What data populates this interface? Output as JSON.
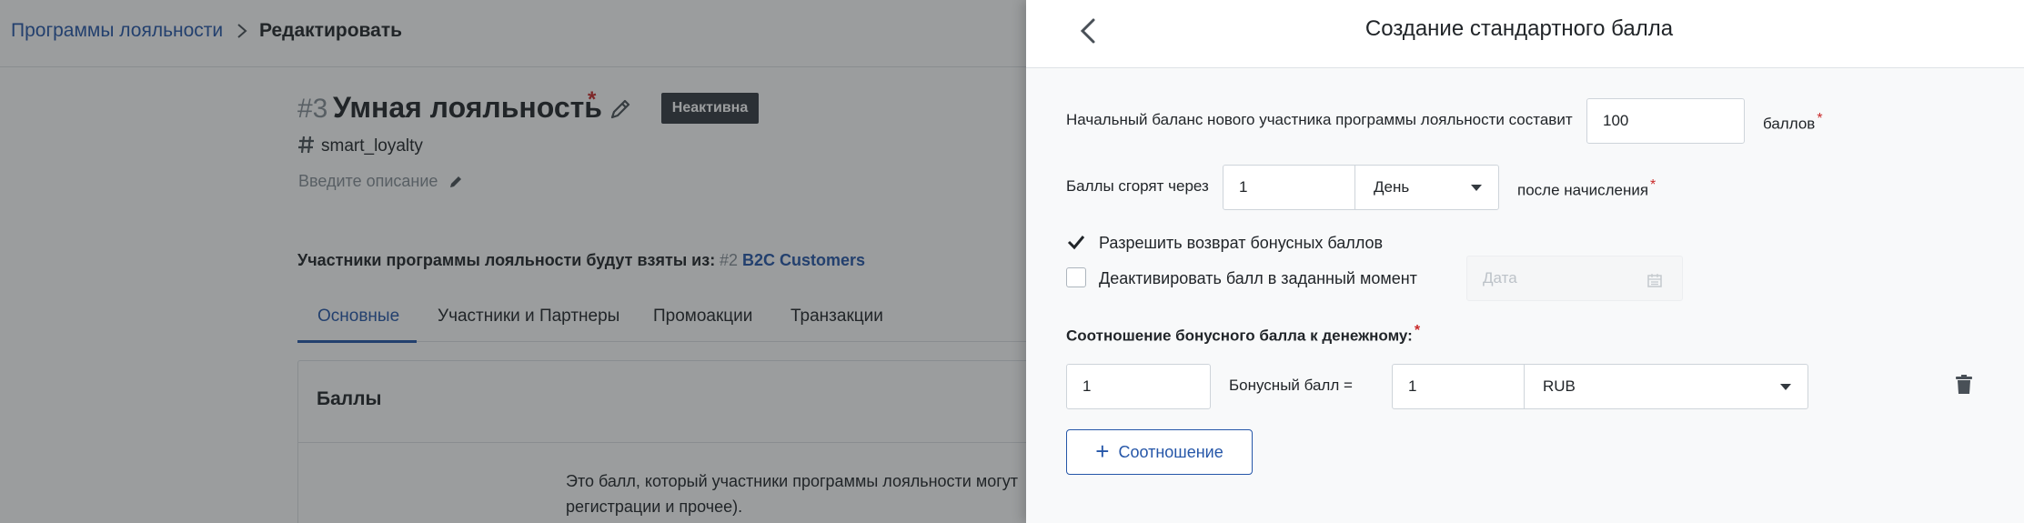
{
  "breadcrumb": {
    "parent": "Программы лояльности",
    "current": "Редактировать"
  },
  "program": {
    "number": "#3",
    "title": "Умная лояльность",
    "required_star": "*",
    "status": "Неактивна",
    "slug": "smart_loyalty",
    "description_placeholder": "Введите описание"
  },
  "source": {
    "label": "Участники программы лояльности будут взяты из:",
    "segment_number": "#2",
    "segment_name": "B2C Customers"
  },
  "tabs": [
    {
      "label": "Основные",
      "active": true
    },
    {
      "label": "Участники и Партнеры",
      "active": false
    },
    {
      "label": "Промоакции",
      "active": false
    },
    {
      "label": "Транзакции",
      "active": false
    }
  ],
  "card": {
    "title": "Баллы",
    "text_line1": "Это балл, который участники программы лояльности могут",
    "text_line2": "регистрации и прочее)."
  },
  "drawer": {
    "title": "Создание стандартного балла",
    "initial_balance": {
      "label": "Начальный баланс нового участника программы лояльности составит",
      "value": "100",
      "suffix": "баллов",
      "required": "*"
    },
    "expiry": {
      "label": "Баллы сгорят через",
      "value": "1",
      "unit": "День",
      "suffix": "после начисления",
      "required": "*"
    },
    "allow_return": {
      "label": "Разрешить возврат бонусных баллов",
      "checked": true
    },
    "deactivate": {
      "label": "Деактивировать балл в заданный момент",
      "checked": false,
      "date_placeholder": "Дата"
    },
    "ratio": {
      "heading": "Соотношение бонусного балла к денежному:",
      "required": "*",
      "bonus_value": "1",
      "equals_label": "Бонусный балл =",
      "money_value": "1",
      "currency": "RUB"
    },
    "add_ratio_button": "Соотношение"
  },
  "colors": {
    "accent": "#2556a8",
    "required": "#c92a2a",
    "badge_bg": "#343a40"
  }
}
